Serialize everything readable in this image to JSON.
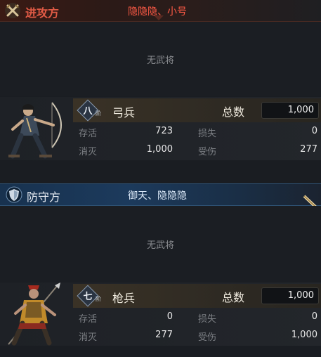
{
  "attack": {
    "side_label": "进攻方",
    "names": "隐隐隐、小号",
    "empty_text": "无武将",
    "unit": {
      "rank": "八",
      "rank_suffix": "阶",
      "type": "弓兵",
      "total_label": "总数",
      "total": "1,000",
      "stats": [
        {
          "label": "存活",
          "value": "723"
        },
        {
          "label": "损失",
          "value": "0"
        },
        {
          "label": "消灭",
          "value": "1,000"
        },
        {
          "label": "受伤",
          "value": "277"
        }
      ]
    }
  },
  "defend": {
    "side_label": "防守方",
    "names": "御天、隐隐隐",
    "empty_text": "无武将",
    "unit": {
      "rank": "七",
      "rank_suffix": "阶",
      "type": "枪兵",
      "total_label": "总数",
      "total": "1,000",
      "stats": [
        {
          "label": "存活",
          "value": "0"
        },
        {
          "label": "损失",
          "value": "0"
        },
        {
          "label": "消灭",
          "value": "277"
        },
        {
          "label": "受伤",
          "value": "1,000"
        }
      ]
    }
  },
  "icons": {
    "attack_emblem": "crossed-swords-icon",
    "defend_emblem": "shield-icon",
    "next": "chevron-right-icon"
  },
  "colors": {
    "attack_accent": "#e05a45",
    "defend_accent": "#1c3a5c",
    "gold_panel": "#3a3226"
  }
}
